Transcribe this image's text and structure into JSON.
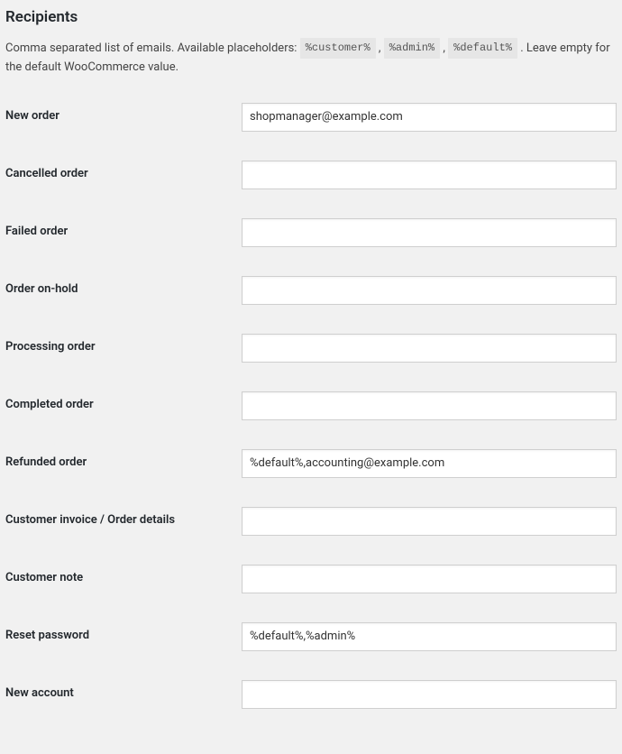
{
  "section": {
    "title": "Recipients",
    "desc_before": "Comma separated list of emails. Available placeholders: ",
    "placeholder1": "%customer%",
    "placeholder2": "%admin%",
    "placeholder3": "%default%",
    "desc_after": " . Leave empty for the default WooCommerce value."
  },
  "fields": {
    "new_order": {
      "label": "New order",
      "value": "shopmanager@example.com"
    },
    "cancelled_order": {
      "label": "Cancelled order",
      "value": ""
    },
    "failed_order": {
      "label": "Failed order",
      "value": ""
    },
    "order_on_hold": {
      "label": "Order on-hold",
      "value": ""
    },
    "processing_order": {
      "label": "Processing order",
      "value": ""
    },
    "completed_order": {
      "label": "Completed order",
      "value": ""
    },
    "refunded_order": {
      "label": "Refunded order",
      "value": "%default%,accounting@example.com"
    },
    "customer_invoice": {
      "label": "Customer invoice / Order details",
      "value": ""
    },
    "customer_note": {
      "label": "Customer note",
      "value": ""
    },
    "reset_password": {
      "label": "Reset password",
      "value": "%default%,%admin%"
    },
    "new_account": {
      "label": "New account",
      "value": ""
    }
  }
}
